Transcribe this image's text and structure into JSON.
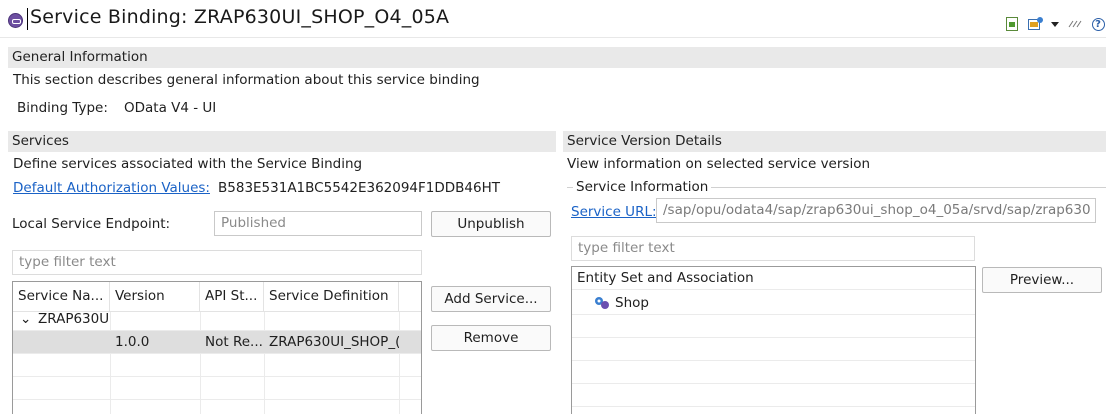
{
  "title": {
    "text": "Service Binding: ZRAP630UI_SHOP_O4_05A"
  },
  "toolbar": {
    "icons": [
      "new-file-icon",
      "publish-icon",
      "dropdown-arrow-icon",
      "menu-icon",
      "help-icon"
    ],
    "help_glyph": "?"
  },
  "general": {
    "header": "General Information",
    "description": "This section describes general information about this service binding",
    "binding_type_label": "Binding Type:",
    "binding_type_value": "OData V4 - UI"
  },
  "services": {
    "header": "Services",
    "description": "Define services associated with the Service Binding",
    "auth_link": "Default Authorization Values:",
    "auth_value": "B583E531A1BC5542E362094F1DDB46HT",
    "endpoint_label": "Local Service Endpoint:",
    "endpoint_value": "Published",
    "unpublish_label": "Unpublish",
    "filter_placeholder": "type filter text",
    "columns": [
      "Service Na...",
      "Version",
      "API St...",
      "Service Definition"
    ],
    "group_row": {
      "expander": "⌄",
      "name": "ZRAP630U"
    },
    "version_row": {
      "version": "1.0.0",
      "api_state": "Not Re...",
      "definition": "ZRAP630UI_SHOP_("
    },
    "add_service_label": "Add Service...",
    "remove_label": "Remove"
  },
  "version_details": {
    "header": "Service Version Details",
    "description": "View information on selected service version",
    "group_title": "Service Information",
    "url_link": "Service URL:",
    "url_value": "/sap/opu/odata4/sap/zrap630ui_shop_o4_05a/srvd/sap/zrap630",
    "filter_placeholder": "type filter text",
    "entity_header": "Entity Set and Association",
    "entity_item": "Shop",
    "preview_label": "Preview..."
  }
}
